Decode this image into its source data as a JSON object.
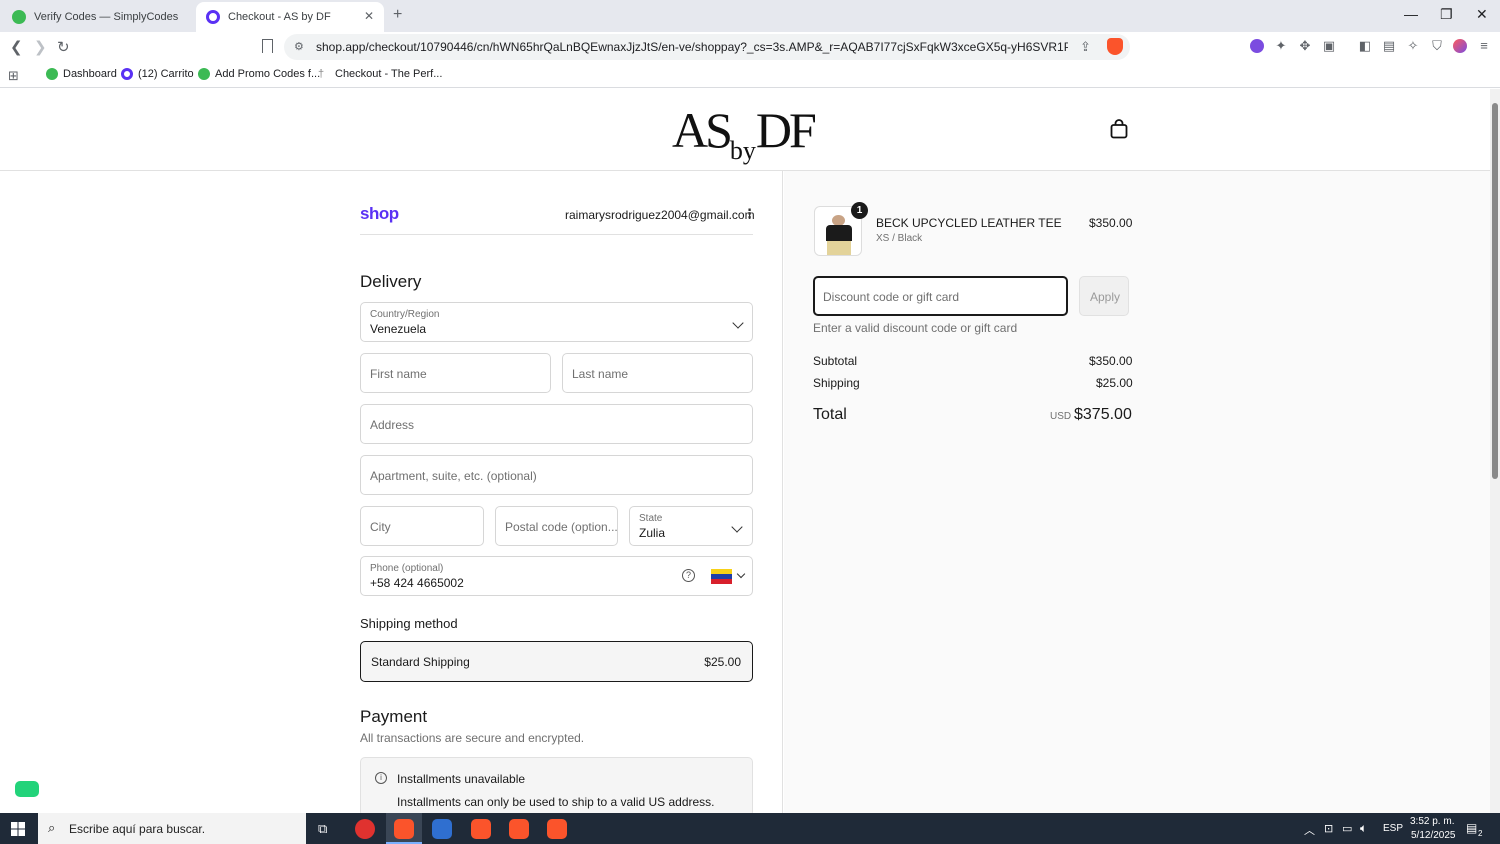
{
  "browser": {
    "tabs": [
      {
        "title": "Verify Codes — SimplyCodes",
        "color": "#3cba54",
        "active": false
      },
      {
        "title": "Checkout - AS by DF",
        "color": "#5a31f4",
        "active": true
      }
    ],
    "url": "shop.app/checkout/10790446/cn/hWN65hrQaLnBQEwnaxJjzJtS/en-ve/shoppay?_cs=3s.AMP&_r=AQAB7I77cjSxFqkW3xceGX5q-yH6SVR1Pnacs0kS8mE2e3...",
    "bookmarks": [
      {
        "label": "Dashboard",
        "color": "#3cba54"
      },
      {
        "label": "(12) Carrito",
        "color": "#5a31f4"
      },
      {
        "label": "Add Promo Codes f...",
        "color": "#3cba54"
      },
      {
        "label": "Checkout - The Perf...",
        "color": "#888888"
      }
    ]
  },
  "header": {
    "logo_as": "AS",
    "logo_by": "by",
    "logo_df": "DF"
  },
  "shop": {
    "brand": "shop",
    "brand_color": "#5a31f4",
    "email": "raimarysrodriguez2004@gmail.com"
  },
  "delivery": {
    "title": "Delivery",
    "country_label": "Country/Region",
    "country_value": "Venezuela",
    "first_name_ph": "First name",
    "last_name_ph": "Last name",
    "address_ph": "Address",
    "apartment_ph": "Apartment, suite, etc. (optional)",
    "city_ph": "City",
    "postal_ph": "Postal code (option...",
    "state_label": "State",
    "state_value": "Zulia",
    "phone_label": "Phone (optional)",
    "phone_value": "+58 424 4665002"
  },
  "shipping": {
    "title": "Shipping method",
    "option_name": "Standard Shipping",
    "option_price": "$25.00"
  },
  "payment": {
    "title": "Payment",
    "subtitle": "All transactions are secure and encrypted.",
    "notice_title": "Installments unavailable",
    "notice_text": "Installments can only be used to ship to a valid US address."
  },
  "summary": {
    "item_qty": "1",
    "item_name": "BECK UPCYCLED LEATHER TEE",
    "item_variant": "XS / Black",
    "item_price": "$350.00",
    "discount_ph": "Discount code or gift card",
    "apply_label": "Apply",
    "discount_error": "Enter a valid discount code or gift card",
    "subtotal_label": "Subtotal",
    "subtotal_value": "$350.00",
    "shipping_label": "Shipping",
    "shipping_value": "$25.00",
    "total_label": "Total",
    "currency": "USD",
    "total_value": "$375.00"
  },
  "taskbar": {
    "search_text": "Escribe aquí para buscar.",
    "language": "ESP",
    "time": "3:52 p. m.",
    "date": "5/12/2025",
    "notif_count": "2"
  }
}
